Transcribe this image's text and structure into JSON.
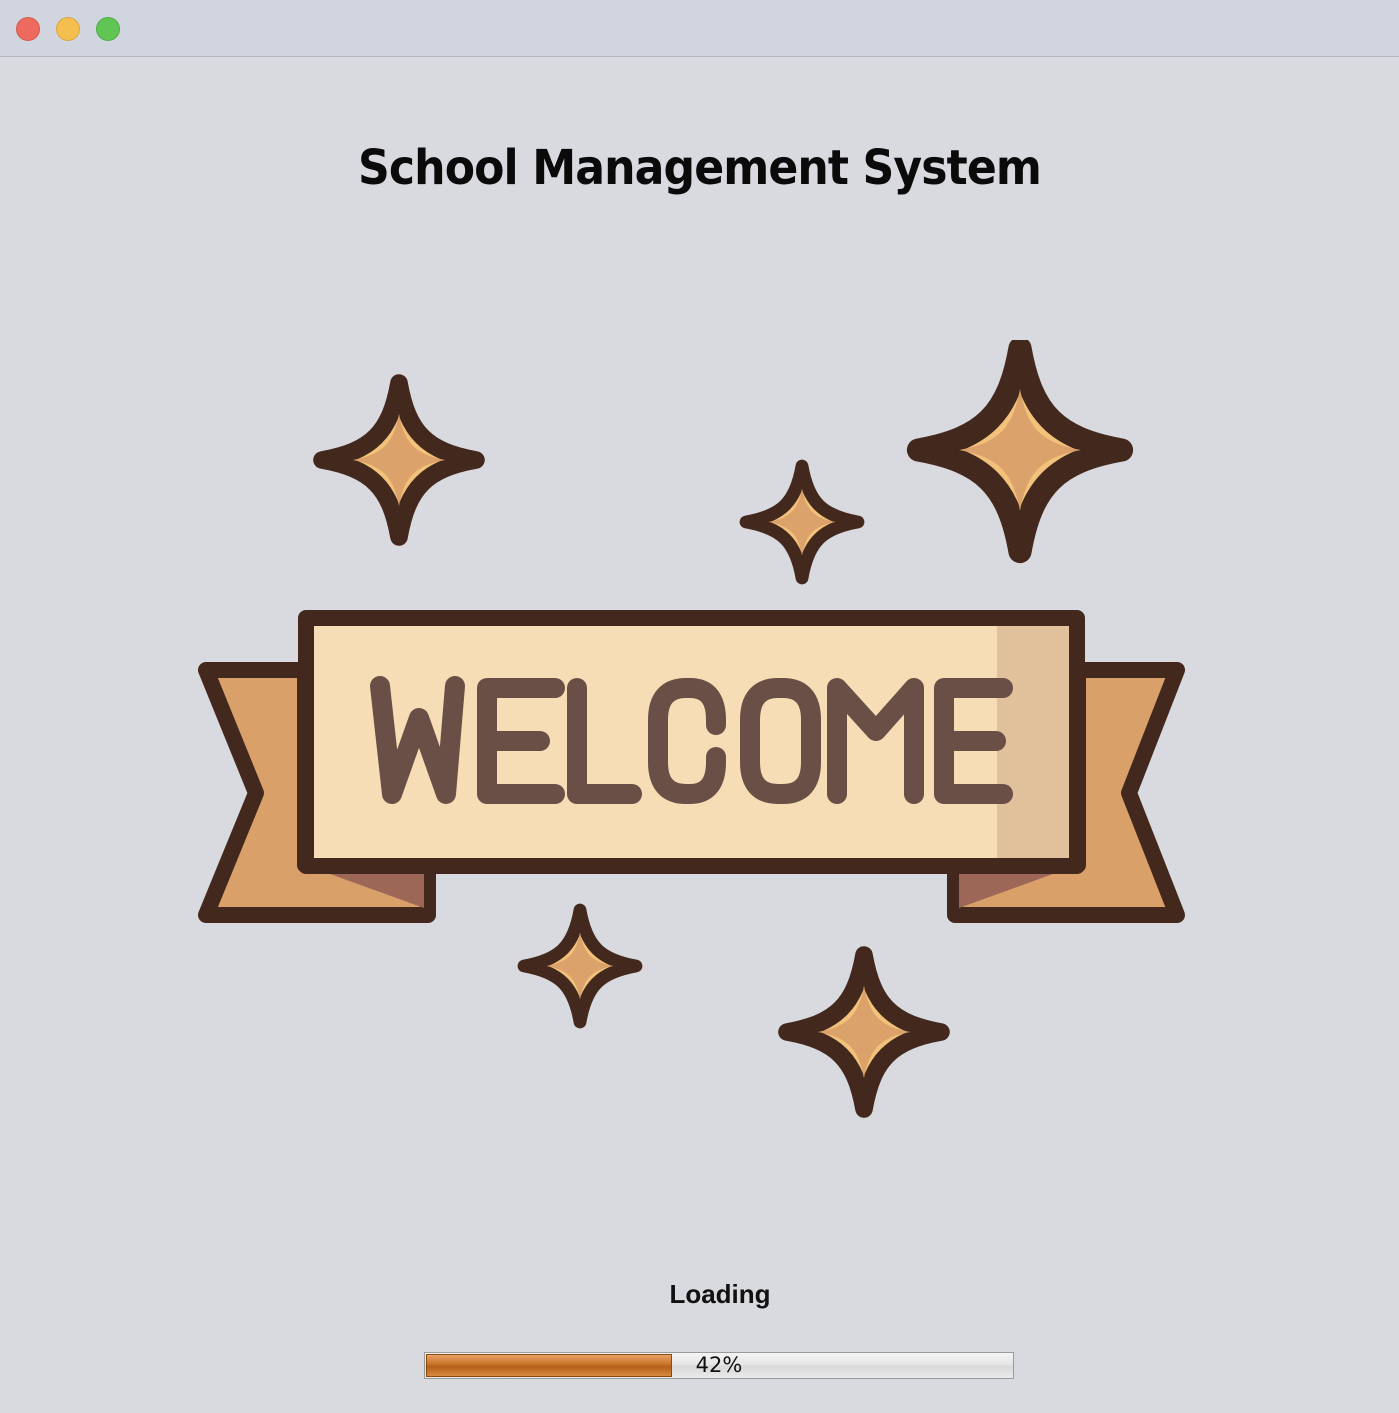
{
  "window": {
    "title_bar_buttons": [
      "close",
      "minimize",
      "zoom"
    ]
  },
  "app": {
    "title": "School Management System"
  },
  "banner": {
    "text": "WELCOME",
    "icon": "welcome-banner-icon"
  },
  "loading": {
    "label": "Loading",
    "progress_fraction": 0.42,
    "progress_text": "42%"
  },
  "colors": {
    "window_bg": "#d9dadf",
    "titlebar_bg": "#d1d5e0",
    "close": "#ee6a5e",
    "minimize": "#f5bf4f",
    "zoom": "#61c554",
    "progress_fill": "#c77328"
  }
}
